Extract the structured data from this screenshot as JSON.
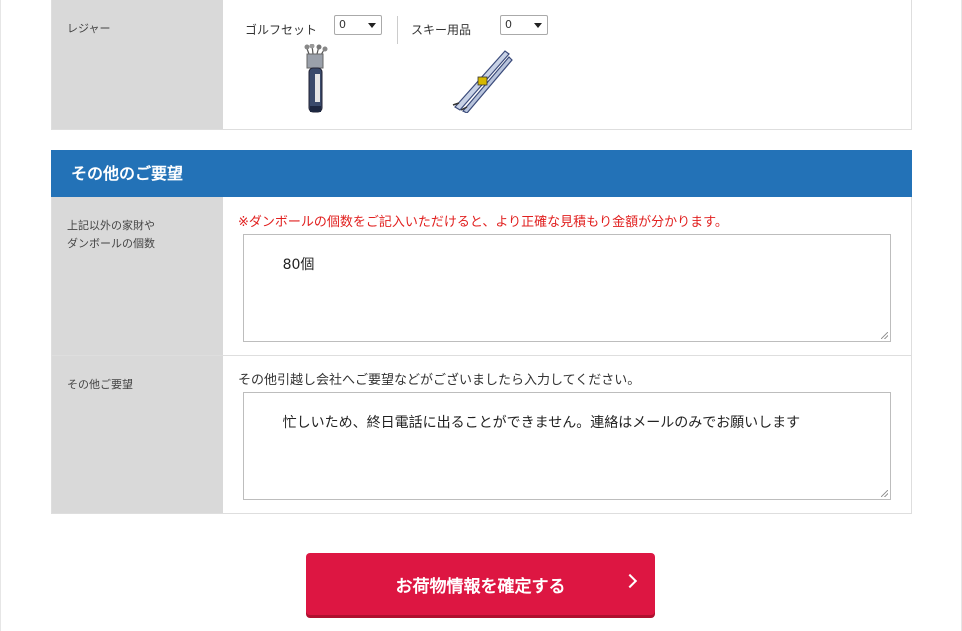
{
  "leisure": {
    "label": "レジャー",
    "items": [
      {
        "label": "ゴルフセット",
        "value": "0",
        "icon": "golf-bag-icon"
      },
      {
        "label": "スキー用品",
        "value": "0",
        "icon": "ski-icon"
      }
    ]
  },
  "other_requests": {
    "title": "その他のご要望",
    "boxes": {
      "label_line1": "上記以外の家財や",
      "label_line2": "ダンボールの個数",
      "note": "※ダンボールの個数をご記入いただけると、より正確な見積もり金額が分かります。",
      "value": "80個"
    },
    "request": {
      "label": "その他ご要望",
      "note": "その他引越し会社へご要望などがございましたら入力してください。",
      "value": "忙しいため、終日電話に出ることができません。連絡はメールのみでお願いします"
    }
  },
  "submit": {
    "label": "お荷物情報を確定する"
  },
  "colors": {
    "section_header": "#2372b7",
    "submit": "#dd1642",
    "note_red": "#e1201f"
  }
}
